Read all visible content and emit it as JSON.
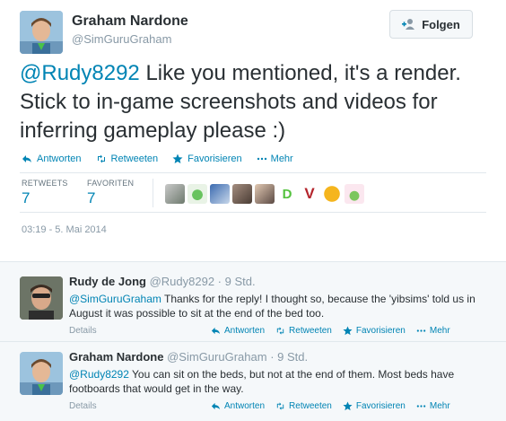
{
  "tweet": {
    "author_name": "Graham Nardone",
    "author_handle": "@SimGuruGraham",
    "follow_label": "Folgen",
    "mention": "@Rudy8292",
    "text": " Like you mentioned, it's a render. Stick to in-game screenshots and videos for inferring gameplay please :)",
    "actions": {
      "reply": "Antworten",
      "retweet": "Retweeten",
      "favorite": "Favorisieren",
      "more": "Mehr"
    },
    "stats": {
      "retweets_label": "RETWEETS",
      "retweets": "7",
      "favorites_label": "FAVORITEN",
      "favorites": "7"
    },
    "timestamp": "03:19 - 5. Mai 2014"
  },
  "replies": [
    {
      "name": "Rudy de Jong",
      "handle": "@Rudy8292",
      "time": "· 9 Std.",
      "mention": "@SimGuruGraham",
      "text": " Thanks for the reply! I thought so, because the 'yibsims' told us in August it was possible to sit at the end of the bed too.",
      "details": "Details",
      "reply": "Antworten",
      "retweet": "Retweeten",
      "favorite": "Favorisieren",
      "more": "Mehr"
    },
    {
      "name": "Graham Nardone",
      "handle": "@SimGuruGraham",
      "time": "· 9 Std.",
      "mention": "@Rudy8292",
      "text": " You can sit on the beds, but not at the end of them. Most beds have footboards that would get in the way.",
      "details": "Details",
      "reply": "Antworten",
      "retweet": "Retweeten",
      "favorite": "Favorisieren",
      "more": "Mehr"
    }
  ],
  "colors": {
    "link": "#0084b4",
    "text": "#292f33",
    "muted": "#8899a6",
    "reply_bg": "#f5f8fa"
  }
}
